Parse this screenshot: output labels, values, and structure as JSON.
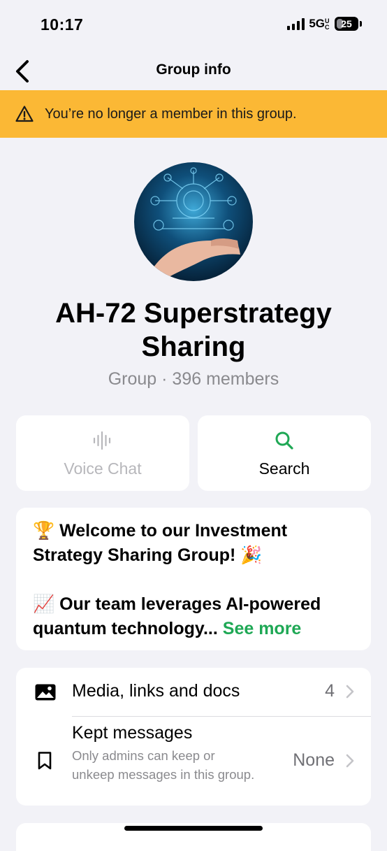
{
  "status_bar": {
    "time": "10:17",
    "network": "5G",
    "network_suffix": "UC",
    "battery": "25"
  },
  "nav": {
    "title": "Group info",
    "back_icon": "chevron-left-icon"
  },
  "banner": {
    "icon": "warning-icon",
    "text": "You’re no longer a member in this group.",
    "color": "#fbb835"
  },
  "group": {
    "name": "AH-72 Superstrategy Sharing",
    "subtitle": "Group · 396 members"
  },
  "actions": {
    "voice_chat": {
      "label": "Voice Chat",
      "icon": "waveform-icon",
      "enabled": false
    },
    "search": {
      "label": "Search",
      "icon": "search-icon",
      "color": "#1fa855"
    }
  },
  "description": {
    "line1": "🏆 Welcome to our Investment Strategy Sharing Group! 🎉",
    "line2": "📈 Our team leverages AI-powered quantum technology...",
    "see_more": "See more",
    "link_color": "#1fa855"
  },
  "info_list": {
    "media": {
      "label": "Media, links and docs",
      "value": "4",
      "icon": "image-icon"
    },
    "kept": {
      "label": "Kept messages",
      "sub": "Only admins can keep or unkeep messages in this group.",
      "value": "None",
      "icon": "bookmark-icon"
    }
  },
  "colors": {
    "background": "#f2f2f7",
    "card": "#ffffff",
    "accent_green": "#1fa855",
    "banner": "#fbb835"
  }
}
